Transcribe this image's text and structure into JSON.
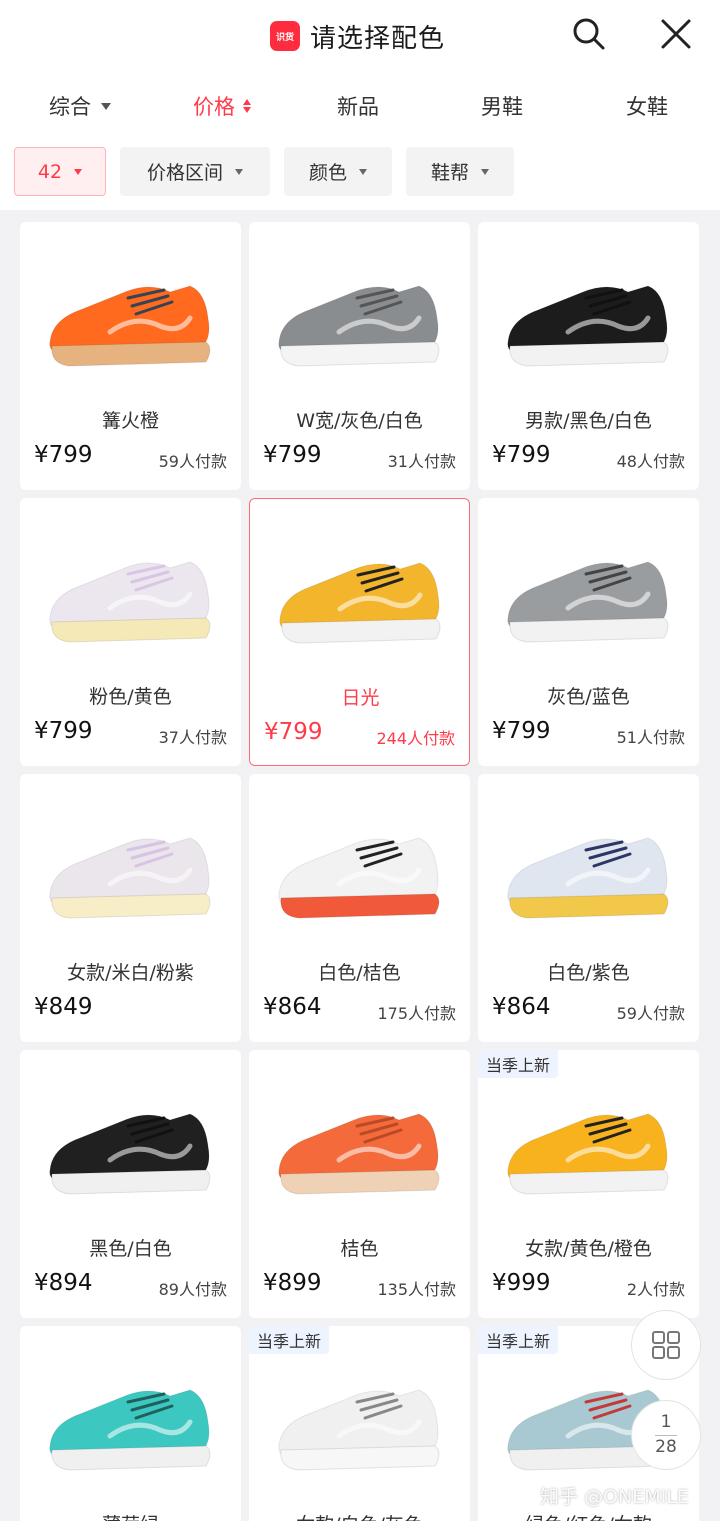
{
  "header": {
    "brand_label": "识货",
    "title": "请选择配色",
    "search_icon": "search-icon",
    "close_icon": "close-icon"
  },
  "sort_tabs": [
    {
      "label": "综合"
    },
    {
      "label": "价格",
      "active": true
    },
    {
      "label": "新品"
    },
    {
      "label": "男鞋"
    },
    {
      "label": "女鞋"
    }
  ],
  "filters": [
    {
      "label": "42",
      "selected": true
    },
    {
      "label": "价格区间"
    },
    {
      "label": "颜色"
    },
    {
      "label": "鞋帮"
    }
  ],
  "products": [
    {
      "name": "篝火橙",
      "price": "¥799",
      "sold": "59人付款",
      "upper": "#ff6a1f",
      "sole": "#e6b27f",
      "lace": "#334455"
    },
    {
      "name": "W宽/灰色/白色",
      "price": "¥799",
      "sold": "31人付款",
      "upper": "#8a8d90",
      "sole": "#f4f4f4",
      "lace": "#555555"
    },
    {
      "name": "男款/黑色/白色",
      "price": "¥799",
      "sold": "48人付款",
      "upper": "#1c1c1c",
      "sole": "#f2f2f2",
      "lace": "#111111"
    },
    {
      "name": "粉色/黄色",
      "price": "¥799",
      "sold": "37人付款",
      "upper": "#ece6ee",
      "sole": "#f6e9b8",
      "lace": "#d9c6e6"
    },
    {
      "name": "日光",
      "price": "¥799",
      "sold": "244人付款",
      "upper": "#f3b52c",
      "sole": "#f2f2f2",
      "lace": "#222222",
      "highlight": true
    },
    {
      "name": "灰色/蓝色",
      "price": "¥799",
      "sold": "51人付款",
      "upper": "#9a9da0",
      "sole": "#f2f2f2",
      "lace": "#444444"
    },
    {
      "name": "女款/米白/粉紫",
      "price": "¥849",
      "sold": "",
      "upper": "#ebe5ec",
      "sole": "#f7eec8",
      "lace": "#d7c3e3"
    },
    {
      "name": "白色/桔色",
      "price": "¥864",
      "sold": "175人付款",
      "upper": "#f2f2f2",
      "sole": "#f05a3a",
      "lace": "#222222"
    },
    {
      "name": "白色/紫色",
      "price": "¥864",
      "sold": "59人付款",
      "upper": "#dfe6f0",
      "sole": "#f1c84a",
      "lace": "#2c3566"
    },
    {
      "name": "黑色/白色",
      "price": "¥894",
      "sold": "89人付款",
      "upper": "#202020",
      "sole": "#f0f0f0",
      "lace": "#111111"
    },
    {
      "name": "桔色",
      "price": "¥899",
      "sold": "135人付款",
      "upper": "#f46a3a",
      "sole": "#efd2b5",
      "lace": "#b84a2a"
    },
    {
      "name": "女款/黄色/橙色",
      "price": "¥999",
      "sold": "2人付款",
      "upper": "#f8b21e",
      "sole": "#f2f2f2",
      "lace": "#222222",
      "tag": "当季上新"
    },
    {
      "name": "薄荷绿",
      "price": "",
      "sold": "",
      "upper": "#3cc8c0",
      "sole": "#f0f0f0",
      "lace": "#1f5f5c"
    },
    {
      "name": "女款/白色/灰色",
      "price": "",
      "sold": "",
      "upper": "#f0f0f0",
      "sole": "#f7f7f7",
      "lace": "#888888",
      "tag": "当季上新"
    },
    {
      "name": "绿色/红色/女款",
      "price": "",
      "sold": "",
      "upper": "#a9c9d2",
      "sole": "#f0f0f0",
      "lace": "#c43a3a",
      "tag": "当季上新"
    }
  ],
  "floating": {
    "grid_icon": "grid-icon",
    "page_current": "1",
    "page_total": "28"
  },
  "watermark": "知乎 @ONEMILE"
}
